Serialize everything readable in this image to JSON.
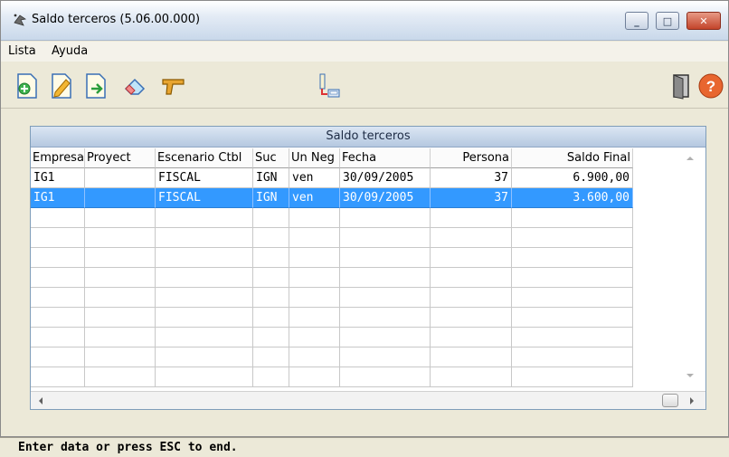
{
  "window": {
    "title": "Saldo terceros (5.06.00.000)"
  },
  "menu": {
    "items": [
      "Lista",
      "Ayuda"
    ]
  },
  "toolbar": {
    "left_icons": [
      "add-page-icon",
      "edit-page-icon",
      "export-page-icon",
      "eraser-icon",
      "gun-icon"
    ],
    "center_icon": "printer-icon",
    "right_icons": [
      "exit-door-icon",
      "help-icon"
    ]
  },
  "grid": {
    "caption": "Saldo terceros",
    "columns": [
      "Empresa",
      "Proyect",
      "Escenario Ctbl",
      "Suc",
      "Un Neg",
      "Fecha",
      "Persona",
      "Saldo Final"
    ],
    "rows": [
      [
        "IG1",
        "",
        "FISCAL",
        "IGN",
        "ven",
        "30/09/2005",
        "37",
        "6.900,00"
      ],
      [
        "IG1",
        "",
        "FISCAL",
        "IGN",
        "ven",
        "30/09/2005",
        "37",
        "3.600,00"
      ]
    ],
    "selected_row": 1
  },
  "status": {
    "text": "Enter data or press ESC to end."
  },
  "colors": {
    "selection": "#3399ff",
    "caption_bg": "#c3d3e8",
    "window_bg": "#ece9d8"
  }
}
